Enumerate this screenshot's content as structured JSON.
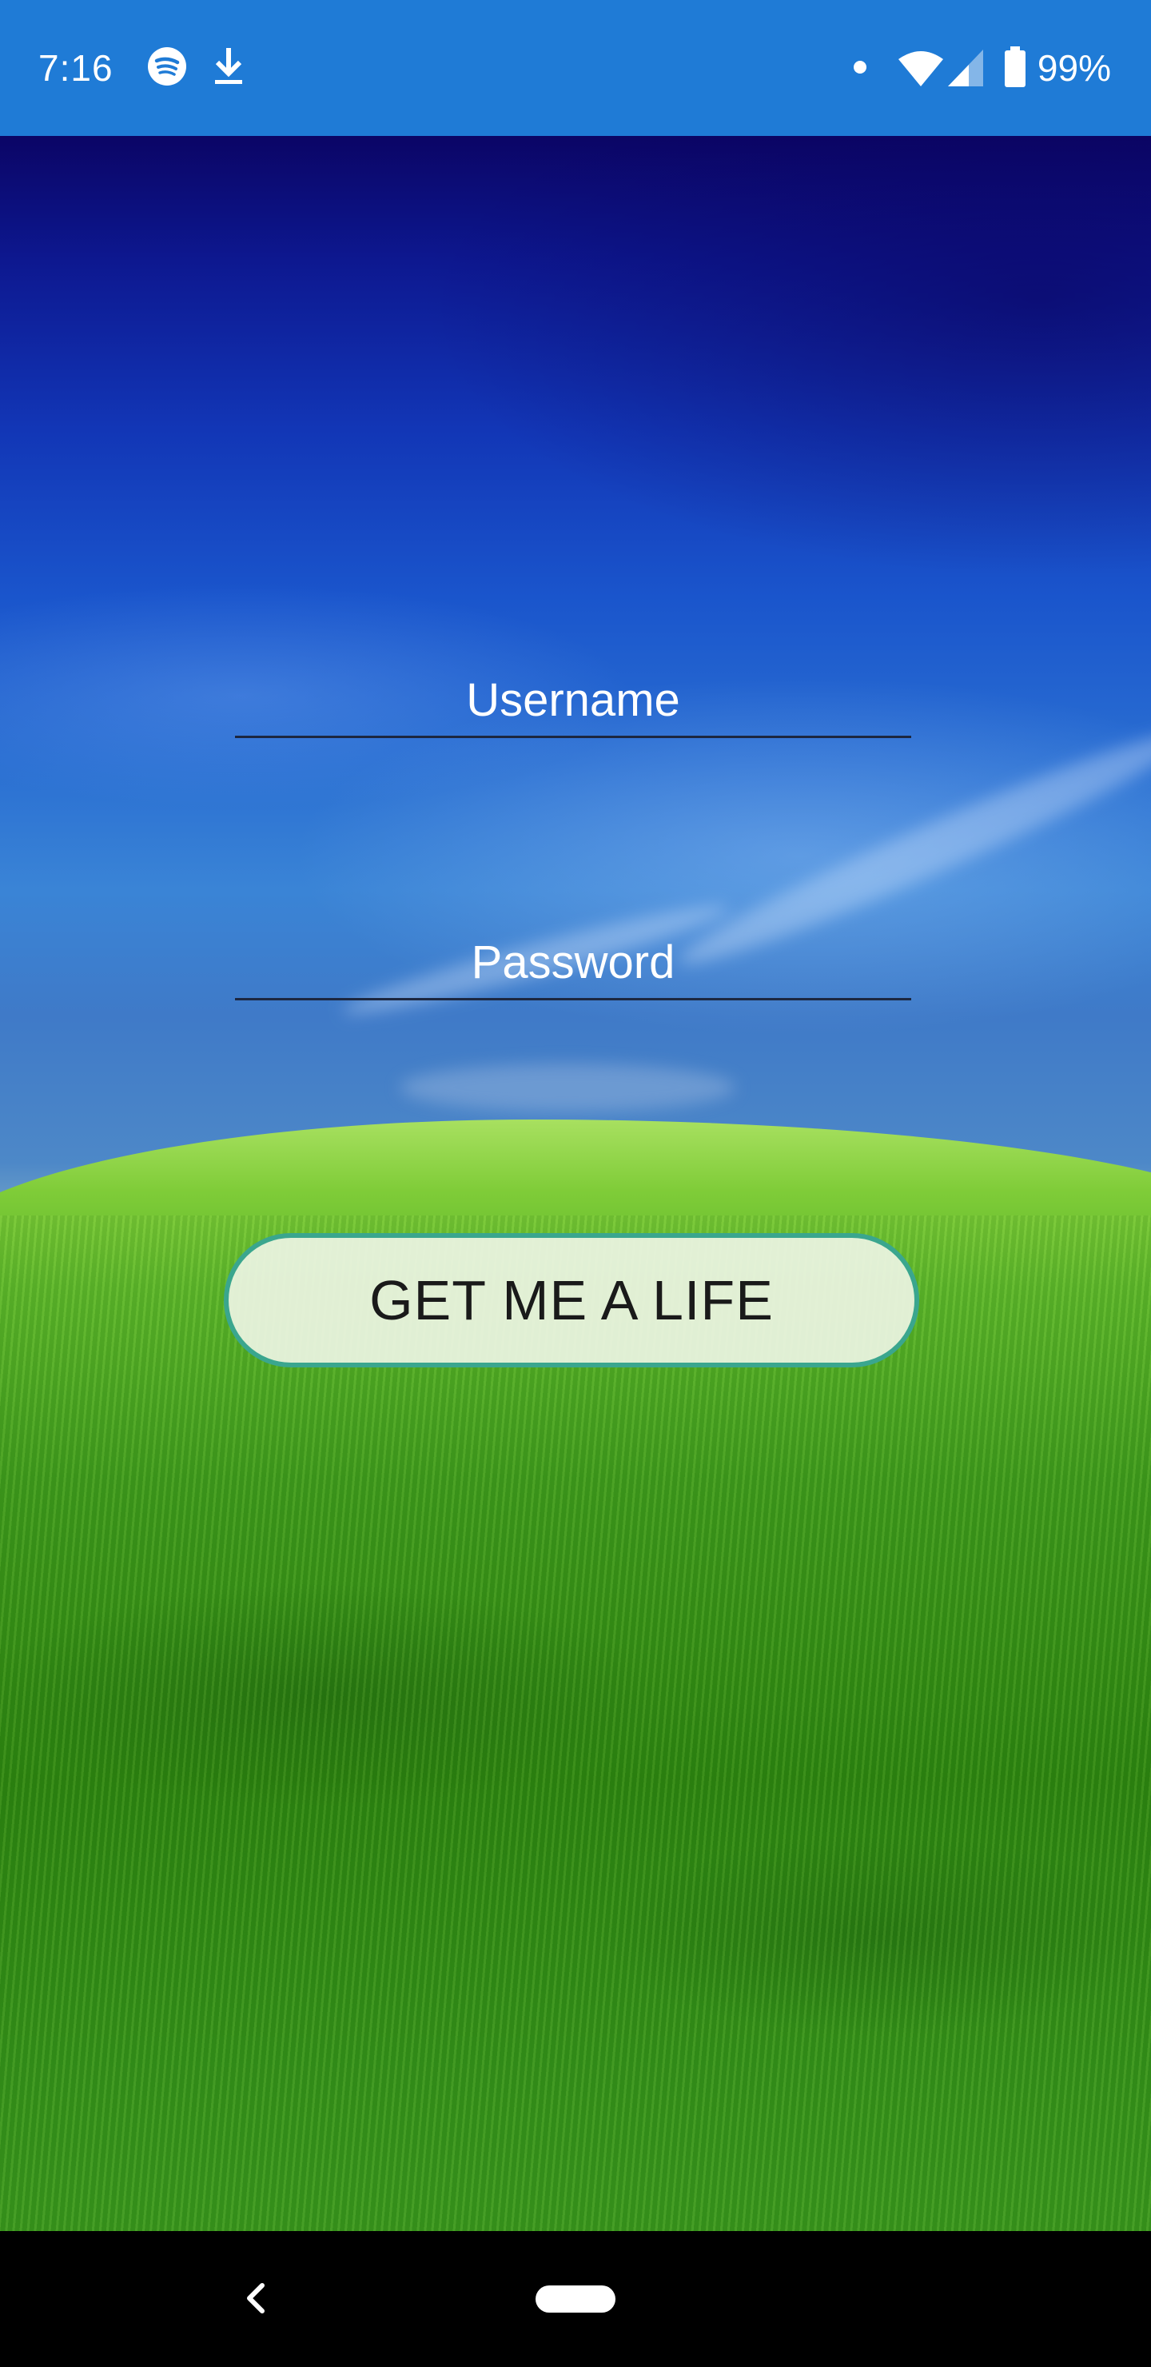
{
  "status_bar": {
    "time": "7:16",
    "battery_percent": "99%",
    "background_color": "#1f7bd6",
    "icons": [
      "spotify-icon",
      "download-icon",
      "notification-dot-icon",
      "wifi-icon",
      "signal-icon",
      "battery-icon"
    ]
  },
  "login_form": {
    "username_placeholder": "Username",
    "password_placeholder": "Password",
    "submit_label": "GET ME A LIFE",
    "button_border_color": "#3aa68e"
  },
  "navigation_bar": {
    "icons": [
      "back-icon",
      "home-pill-icon"
    ]
  }
}
